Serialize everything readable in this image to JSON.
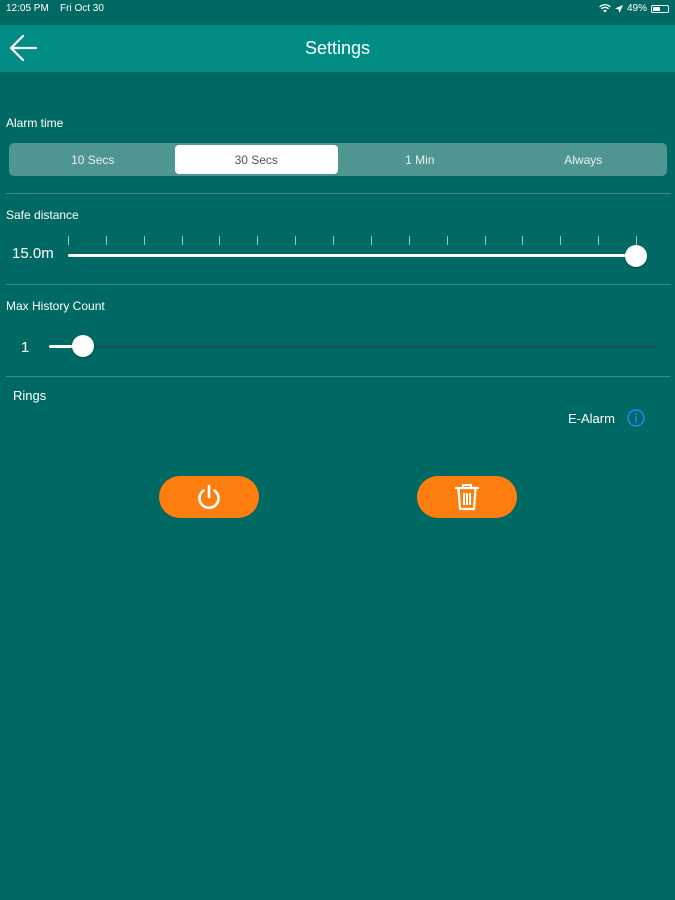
{
  "status_bar": {
    "time": "12:05 PM",
    "date": "Fri Oct 30",
    "battery": "49%",
    "battery_level": 0.49,
    "icons": [
      "wifi-icon",
      "location-arrow-icon",
      "battery-icon"
    ]
  },
  "nav": {
    "title": "Settings",
    "back_icon": "arrow-left-icon"
  },
  "alarm_time": {
    "label": "Alarm time",
    "options": [
      "10 Secs",
      "30 Secs",
      "1 Min",
      "Always"
    ],
    "selected": "30 Secs"
  },
  "safe_distance": {
    "label": "Safe distance",
    "value": "15.0m",
    "fraction": 1.0
  },
  "max_history": {
    "label": "Max History Count",
    "value": "1",
    "fraction": 0.0
  },
  "rings": {
    "label": "Rings",
    "selected_ring": "E-Alarm",
    "info_icon": "info-icon"
  },
  "actions": {
    "power_icon": "power-icon",
    "delete_icon": "trash-icon"
  },
  "colors": {
    "background": "#016964",
    "nav_bar": "#018d86",
    "accent": "#fe7d0f",
    "info_blue": "#1a8cff"
  }
}
